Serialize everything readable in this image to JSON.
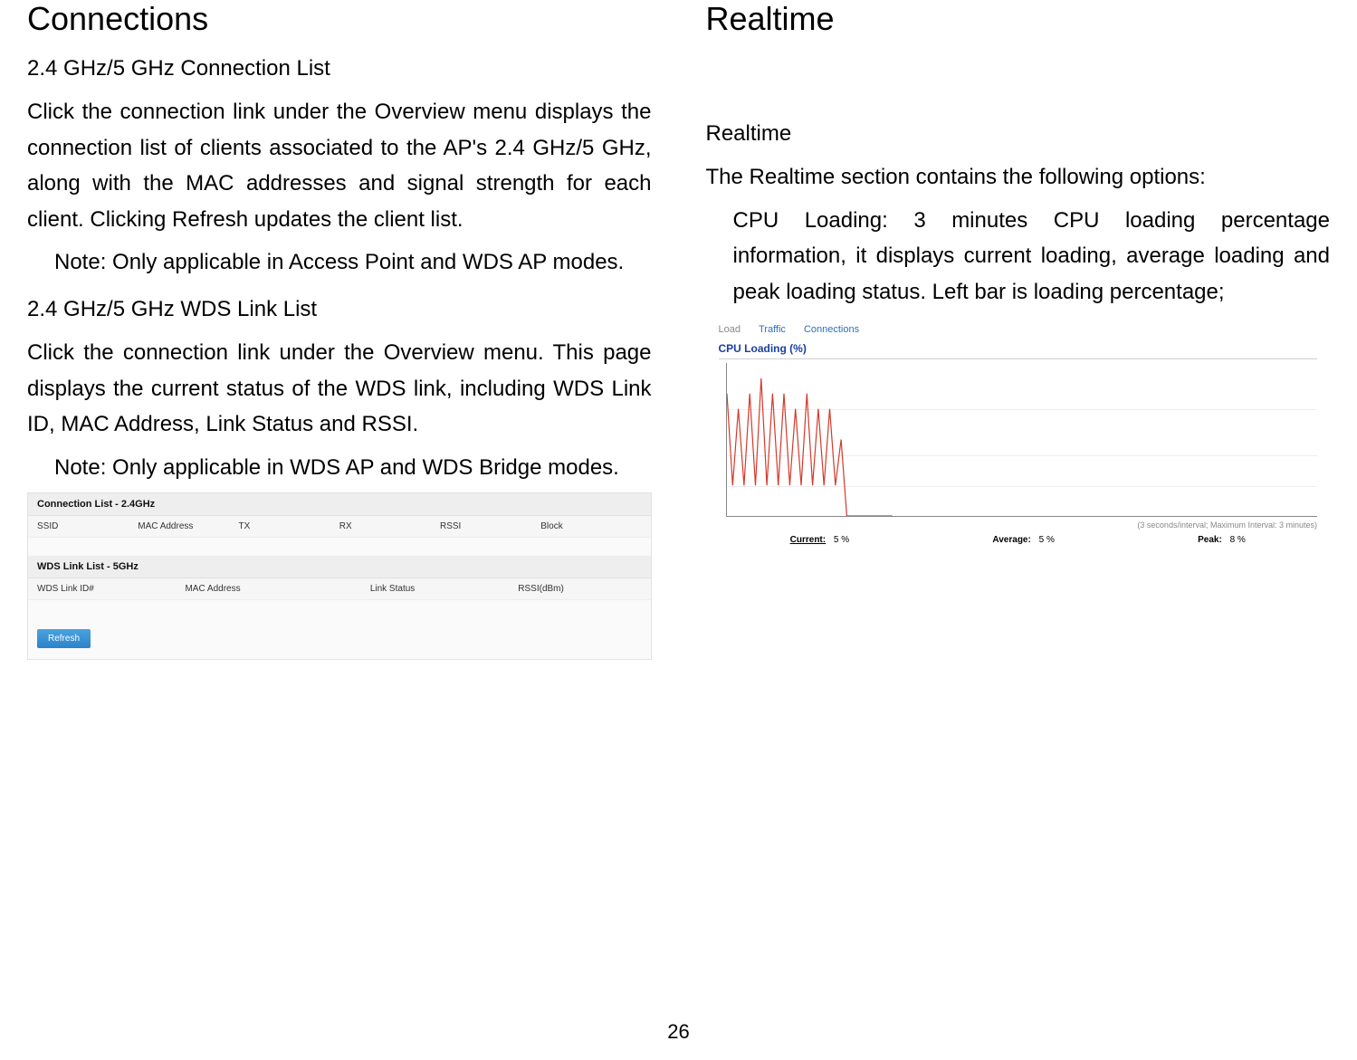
{
  "page_number": "26",
  "left": {
    "heading": "Connections",
    "sec1_title": "2.4 GHz/5 GHz Connection List",
    "sec1_body": "Click the connection link under the Overview menu displays the connection list of clients associated to the AP's 2.4 GHz/5 GHz, along with the MAC addresses and signal strength for each client. Clicking Refresh updates the client list.",
    "sec1_note": "Note: Only applicable in Access Point and WDS AP modes.",
    "sec2_title": "2.4 GHz/5 GHz WDS Link List",
    "sec2_body": "Click the connection link under the Overview menu. This page displays the current status of the WDS link, including WDS Link ID, MAC Address, Link Status and RSSI.",
    "sec2_note": "Note: Only applicable in WDS AP and WDS Bridge modes.",
    "ui": {
      "conn_title": "Connection List - 2.4GHz",
      "conn_headers": [
        "SSID",
        "MAC Address",
        "TX",
        "RX",
        "RSSI",
        "Block"
      ],
      "wds_title": "WDS Link List - 5GHz",
      "wds_headers": [
        "WDS Link ID#",
        "MAC Address",
        "Link Status",
        "RSSI(dBm)"
      ],
      "refresh": "Refresh"
    }
  },
  "right": {
    "heading": "Realtime",
    "sec_title": "Realtime",
    "sec_body": "The Realtime section contains the following options:",
    "cpu_body": "CPU Loading: 3 minutes CPU loading percentage information, it displays current loading, average loading and peak loading status. Left bar is loading percentage;",
    "ui": {
      "tabs": {
        "load": "Load",
        "traffic": "Traffic",
        "connections": "Connections"
      },
      "chart_title": "CPU Loading (%)",
      "meta": "(3 seconds/interval; Maximum Interval: 3 minutes)",
      "stats": {
        "current_label": "Current:",
        "current_value": "5 %",
        "average_label": "Average:",
        "average_value": "5 %",
        "peak_label": "Peak:",
        "peak_value": "8 %"
      }
    }
  },
  "chart_data": {
    "type": "line",
    "title": "CPU Loading (%)",
    "xlabel": "",
    "ylabel": "",
    "ylim": [
      0,
      10
    ],
    "y_ticks": [
      2,
      4,
      7
    ],
    "x": [
      0,
      1,
      2,
      3,
      4,
      5,
      6,
      7,
      8,
      9,
      10,
      11,
      12,
      13,
      14,
      15,
      16,
      17,
      18,
      19,
      20,
      21,
      22,
      23,
      24,
      25,
      26,
      27,
      28,
      29
    ],
    "values": [
      8,
      2,
      7,
      2,
      8,
      2,
      9,
      2,
      8,
      2,
      8,
      2,
      7,
      2,
      8,
      2,
      7,
      2,
      7,
      2,
      5,
      0,
      0,
      0,
      0,
      0,
      0,
      0,
      0,
      0
    ],
    "series_color": "#d33a2c"
  }
}
